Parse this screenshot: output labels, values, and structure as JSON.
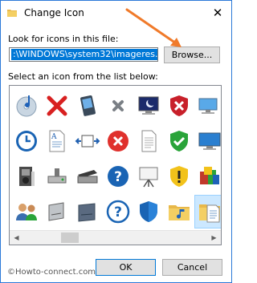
{
  "window": {
    "title": "Change Icon",
    "close_glyph": "✕"
  },
  "file_section": {
    "label": "Look for icons in this file:",
    "path_value": ":\\WINDOWS\\system32\\imageres.dl",
    "browse_label": "Browse..."
  },
  "list_section": {
    "label": "Select an icon from the list below:"
  },
  "icons": [
    "music-disc-icon",
    "red-x-icon",
    "pda-device-icon",
    "small-x-icon",
    "monitor-moon-icon",
    "red-shield-x-icon",
    "computer-network-icon",
    "clock-disc-icon",
    "text-document-icon",
    "resize-box-icon",
    "red-circle-x-icon",
    "blank-document-icon",
    "green-shield-check-icon",
    "monitor-icon",
    "media-player-icon",
    "network-drive-icon",
    "scanner-icon",
    "blue-question-icon",
    "projector-screen-icon",
    "yellow-shield-warning-icon",
    "programs-boxes-icon",
    "users-icon",
    "drive-slab-icon",
    "dark-drive-icon",
    "blue-question-circle-icon",
    "folder-music-icon",
    "folder-document-icon",
    "blank-icon"
  ],
  "selected_icon": "folder-document-icon",
  "buttons": {
    "ok_label": "OK",
    "cancel_label": "Cancel"
  },
  "watermark": "©Howto-connect.com",
  "colors": {
    "accent": "#0078d7",
    "annotation_arrow": "#f07a2a"
  }
}
